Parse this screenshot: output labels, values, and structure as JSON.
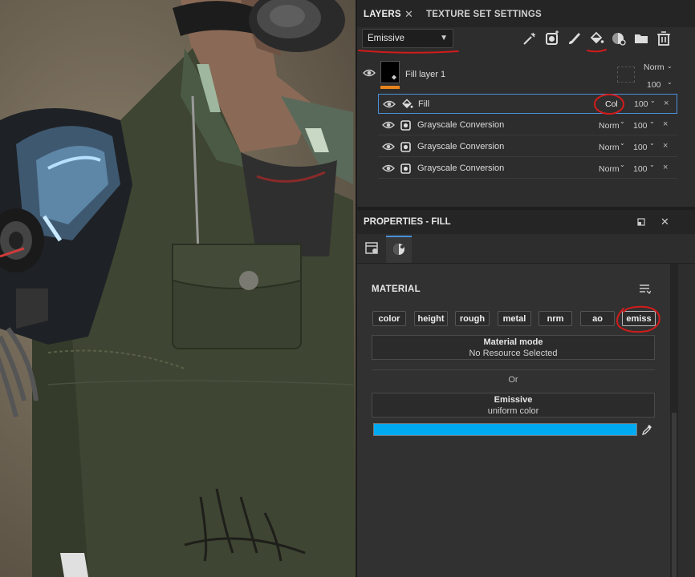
{
  "tabs": {
    "layers": "LAYERS",
    "layers_close": "✕",
    "texture_set": "TEXTURE SET SETTINGS"
  },
  "toolbar": {
    "channel_select": "Emissive",
    "icons": [
      "magic-wand-icon",
      "mask-icon",
      "brush-icon",
      "fill-bucket-icon",
      "smart-material-icon",
      "folder-icon",
      "trash-icon"
    ]
  },
  "layers": {
    "fill_layer": {
      "name": "Fill layer 1",
      "blend": "Norm",
      "opacity": "100"
    },
    "effects": [
      {
        "name": "Fill",
        "blend": "Col",
        "opacity": "100",
        "close": "×"
      },
      {
        "name": "Grayscale Conversion",
        "blend": "Norm",
        "opacity": "100",
        "close": "×"
      },
      {
        "name": "Grayscale Conversion",
        "blend": "Norm",
        "opacity": "100",
        "close": "×"
      },
      {
        "name": "Grayscale Conversion",
        "blend": "Norm",
        "opacity": "100",
        "close": "×"
      }
    ]
  },
  "properties": {
    "title": "PROPERTIES - FILL",
    "close": "✕",
    "section": "MATERIAL",
    "channels": [
      "color",
      "height",
      "rough",
      "metal",
      "nrm",
      "ao",
      "emiss"
    ],
    "material_mode": {
      "title": "Material mode",
      "value": "No Resource Selected"
    },
    "or": "Or",
    "emissive": {
      "title": "Emissive",
      "value": "uniform color",
      "color": "#00aaf0"
    }
  },
  "colors": {
    "accent_orange": "#e8841c",
    "annotation_red": "#d21b1b",
    "selection_blue": "#4a90d9"
  }
}
